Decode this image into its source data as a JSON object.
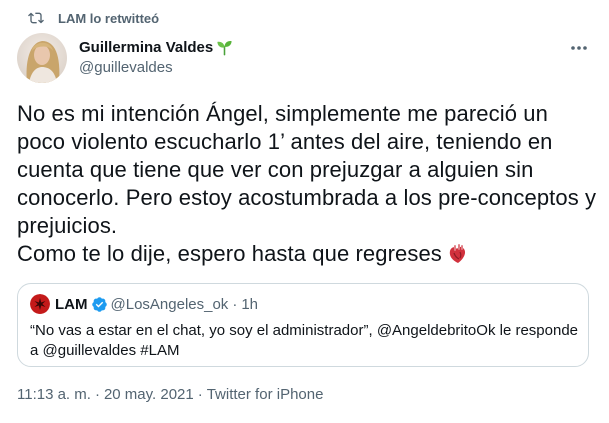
{
  "retweet": {
    "label": "LAM lo retwitteó",
    "icon": "retweet-icon"
  },
  "author": {
    "name": "Guillermina Valdes",
    "handle": "@guillevaldes",
    "badge_icon": "sprout-icon",
    "avatar": "author-avatar"
  },
  "more_icon": "more-icon",
  "tweet": {
    "text": "No es mi intención Ángel, simplemente me pareció un poco violento escucharlo 1’ antes del aire, teniendo en cuenta que tiene que ver con prejuzgar a alguien sin conocerlo. Pero estoy acostumbrada a los pre-conceptos y prejuicios.\nComo te lo dije, espero hasta que regreses",
    "emoji_icon": "anatomical-heart-icon"
  },
  "quote": {
    "name": "LAM",
    "verified_icon": "verified-icon",
    "handle": "@LosAngeles_ok",
    "separator": "·",
    "time": "1h",
    "text": "“No vas a estar en el chat, yo soy el administrador”, @AngeldebritoOk le responde a @guillevaldes #LAM"
  },
  "meta": {
    "time": "11:13 a. m.",
    "separator1": "·",
    "date": "20 may. 2021",
    "separator2": "·",
    "source": "Twitter for iPhone"
  },
  "colors": {
    "text": "#0f1419",
    "secondary": "#536471",
    "border": "#cfd9de",
    "verified": "#1d9bf0",
    "lam_brand": "#c41a1a"
  }
}
